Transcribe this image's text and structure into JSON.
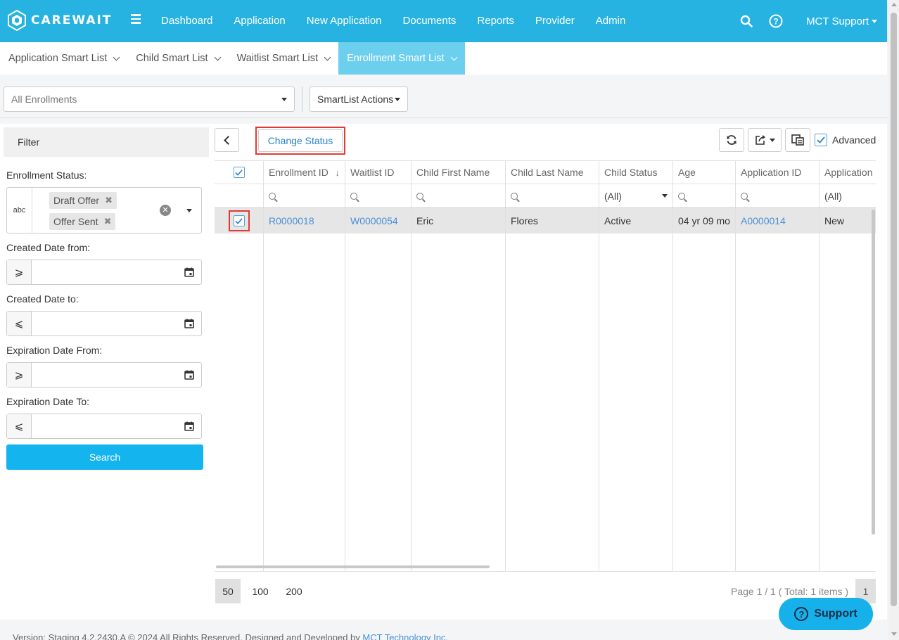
{
  "app": {
    "logo_text": "CAREWAIT"
  },
  "nav": {
    "items": [
      "Dashboard",
      "Application",
      "New Application",
      "Documents",
      "Reports",
      "Provider",
      "Admin"
    ],
    "user": "MCT Support"
  },
  "tabs": [
    {
      "label": "Application Smart List",
      "active": false
    },
    {
      "label": "Child Smart List",
      "active": false
    },
    {
      "label": "Waitlist Smart List",
      "active": false
    },
    {
      "label": "Enrollment Smart List",
      "active": true
    }
  ],
  "toolbar": {
    "view_select": "All Enrollments",
    "actions_select": "SmartList Actions"
  },
  "filter": {
    "title": "Filter",
    "enrollment_status_label": "Enrollment Status:",
    "abc_icon_text": "abc",
    "selected_statuses": [
      "Draft Offer",
      "Offer Sent"
    ],
    "created_from_label": "Created Date from:",
    "created_to_label": "Created Date to:",
    "expiration_from_label": "Expiration Date From:",
    "expiration_to_label": "Expiration Date To:",
    "op_gte": "⩾",
    "op_lte": "⩽",
    "search_label": "Search"
  },
  "grid_toolbar": {
    "change_status_label": "Change Status",
    "advanced_label": "Advanced",
    "advanced_checked": true
  },
  "grid": {
    "columns": [
      "",
      "Enrollment ID",
      "Waitlist ID",
      "Child First Name",
      "Child Last Name",
      "Child Status",
      "Age",
      "Application ID",
      "Application"
    ],
    "filter_values": {
      "child_status": "(All)",
      "application": "(All)"
    },
    "rows": [
      {
        "enrollment_id": "R0000018",
        "waitlist_id": "W0000054",
        "first_name": "Eric",
        "last_name": "Flores",
        "child_status": "Active",
        "age": "04 yr 09 mo",
        "application_id": "A0000014",
        "application": "New",
        "selected": true
      }
    ]
  },
  "pager": {
    "sizes": [
      "50",
      "100",
      "200"
    ],
    "active_size": "50",
    "info": "Page 1 / 1 ( Total: 1 items )",
    "page": "1"
  },
  "support_label": "Support",
  "footer": {
    "text": "Version: Staging 4.2.2430.A © 2024 All Rights Reserved. Designed and Developed by ",
    "link": "MCT Technology Inc."
  },
  "colors": {
    "nav_bg": "#26b3e2",
    "active_tab": "#6ccfee",
    "primary_btn": "#14b4ef",
    "highlight_border": "#e53935",
    "link": "#4a8fd6"
  }
}
